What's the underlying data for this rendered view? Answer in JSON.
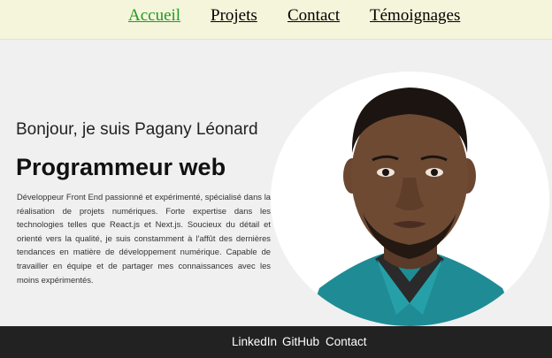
{
  "nav": {
    "items": [
      {
        "label": "Accueil"
      },
      {
        "label": "Projets"
      },
      {
        "label": "Contact"
      },
      {
        "label": "Témoignages"
      }
    ]
  },
  "hero": {
    "greeting": "Bonjour, je suis Pagany Léonard",
    "title": "Programmeur web",
    "bio": "Développeur Front End passionné et expérimenté, spécialisé dans la réalisation de projets numériques. Forte expertise dans les technologies telles que React.js et Next.js. Soucieux du détail et orienté vers la qualité, je suis constamment à l'affût des dernières tendances en matière de développement numérique. Capable de travailler en équipe et de partager mes connaissances avec les moins expérimentés."
  },
  "footer": {
    "links": [
      {
        "label": "LinkedIn"
      },
      {
        "label": "GitHub"
      },
      {
        "label": "Contact"
      }
    ]
  },
  "colors": {
    "nav_background": "#f5f5dc",
    "nav_active": "#1f9a1f",
    "page_background": "#f0f0f0",
    "footer_background": "#222222"
  }
}
